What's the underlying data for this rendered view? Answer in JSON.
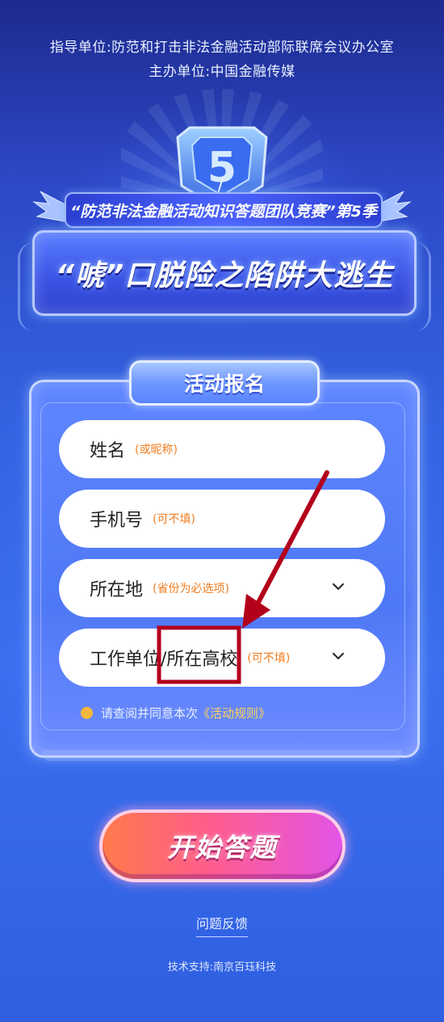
{
  "header": {
    "guide_unit": "指导单位:防范和打击非法金融活动部际联席会议办公室",
    "host_unit": "主办单位:中国金融传媒"
  },
  "banner": {
    "season_title": "“防范非法金融活动知识答题团队竞赛”第5季",
    "main_title": "“唬”口脱险之陷阱大逃生",
    "shield_number": "5"
  },
  "form": {
    "title": "活动报名",
    "fields": [
      {
        "label": "姓名",
        "hint": "(或昵称)",
        "dropdown": false
      },
      {
        "label": "手机号",
        "hint": "(可不填)",
        "dropdown": false
      },
      {
        "label": "所在地",
        "hint": "(省份为必选项)",
        "dropdown": true
      },
      {
        "label": "工作单位/所在高校",
        "hint": "(可不填)",
        "dropdown": true
      }
    ],
    "agree_text": "请查阅并同意本次",
    "agree_link": "《活动规则》"
  },
  "actions": {
    "start_label": "开始答题",
    "feedback_label": "问题反馈"
  },
  "footer": {
    "support": "技术支持:南京百珏科技"
  },
  "colors": {
    "hint": "#f07d20",
    "agree_dot": "#f4b83e",
    "annotation": "#b3001b"
  }
}
